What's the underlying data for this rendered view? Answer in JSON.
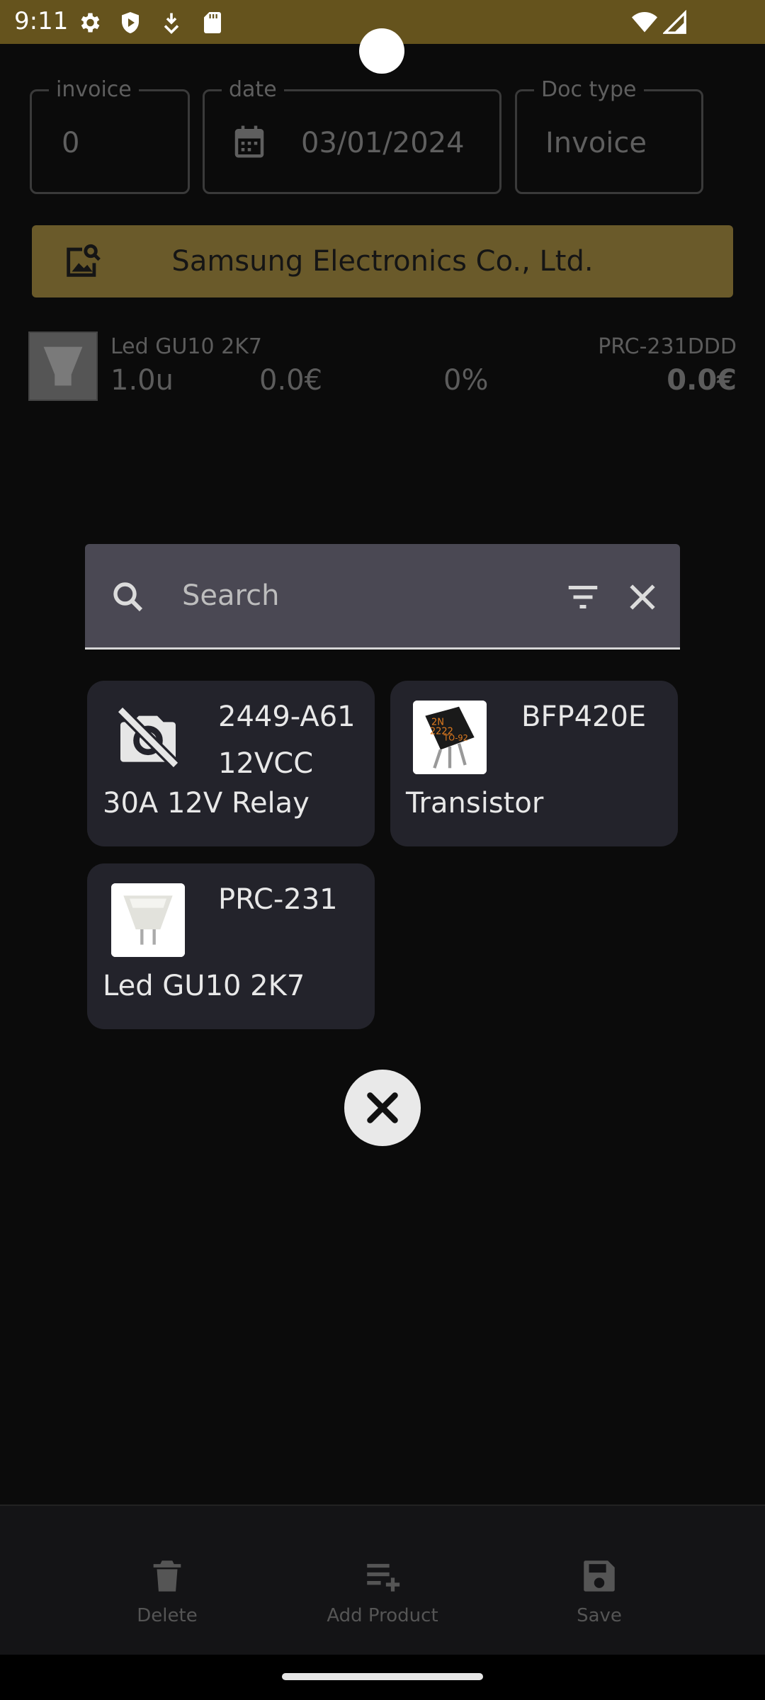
{
  "status_bar": {
    "time": "9:11"
  },
  "form": {
    "invoice": {
      "label": "invoice",
      "value": "0"
    },
    "date": {
      "label": "date",
      "value": "03/01/2024"
    },
    "doc_type": {
      "label": "Doc type",
      "value": "Invoice"
    }
  },
  "supplier": {
    "name": "Samsung Electronics Co., Ltd."
  },
  "line_item": {
    "name": "Led GU10 2K7",
    "code": "PRC-231DDD",
    "quantity": "1.0u",
    "price": "0.0€",
    "discount": "0%",
    "total": "0.0€"
  },
  "search": {
    "placeholder": "Search",
    "value": ""
  },
  "products": [
    {
      "code_line1": "2449-A61",
      "code_line2": "12VCC",
      "name": "30A 12V Relay",
      "icon": "no-photo-icon"
    },
    {
      "code_line1": "BFP420E",
      "code_line2": "",
      "name": "Transistor",
      "icon": "transistor-image"
    },
    {
      "code_line1": "PRC-231",
      "code_line2": "",
      "name": "Led GU10 2K7",
      "icon": "led-bulb-image"
    }
  ],
  "bottom_nav": {
    "delete": "Delete",
    "add_product": "Add Product",
    "save": "Save"
  },
  "colors": {
    "status_bar": "#65531d",
    "supplier_bar": "#6a5a2a",
    "search_bg": "#4a4853",
    "card_bg": "#23232b"
  }
}
